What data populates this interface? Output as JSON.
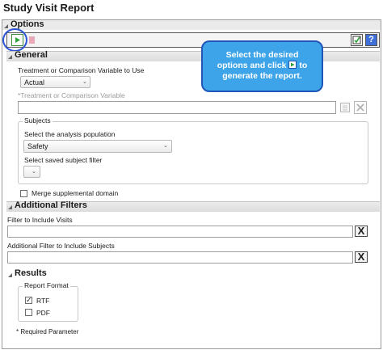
{
  "title": "Study Visit Report",
  "options": {
    "header": "Options",
    "toolbar": {
      "run_icon": "play-icon",
      "stop_icon": "stop-icon",
      "save_icon": "save-settings-icon",
      "help_icon": "help-icon",
      "help_glyph": "?"
    }
  },
  "callout": {
    "line1": "Select the desired",
    "line2a": "options and click",
    "line2b": "to",
    "line3": "generate the report."
  },
  "general": {
    "header": "General",
    "treatment_label": "Treatment or Comparison Variable to Use",
    "treatment_value": "Actual",
    "variable_label": "*Treatment or Comparison Variable",
    "variable_value": "",
    "subjects": {
      "group_title": "Subjects",
      "population_label": "Select the analysis population",
      "population_value": "Safety",
      "filter_label": "Select saved subject filter",
      "filter_value": ""
    },
    "merge_label": "Merge supplemental domain"
  },
  "additional_filters": {
    "header": "Additional Filters",
    "visits_label": "Filter to Include Visits",
    "visits_value": "",
    "subjects_label": "Additional Filter to Include Subjects",
    "subjects_value": "",
    "clear_glyph": "X"
  },
  "results": {
    "header": "Results",
    "group_title": "Report Format",
    "formats": [
      {
        "label": "RTF",
        "checked": true
      },
      {
        "label": "PDF",
        "checked": false
      }
    ],
    "checkmark": "✓"
  },
  "required_note": "* Required Parameter",
  "colors": {
    "callout": "#3ea4e9",
    "callout_border": "#1f56b8",
    "run_green": "#2ea33a",
    "highlight": "#2b55d4"
  }
}
